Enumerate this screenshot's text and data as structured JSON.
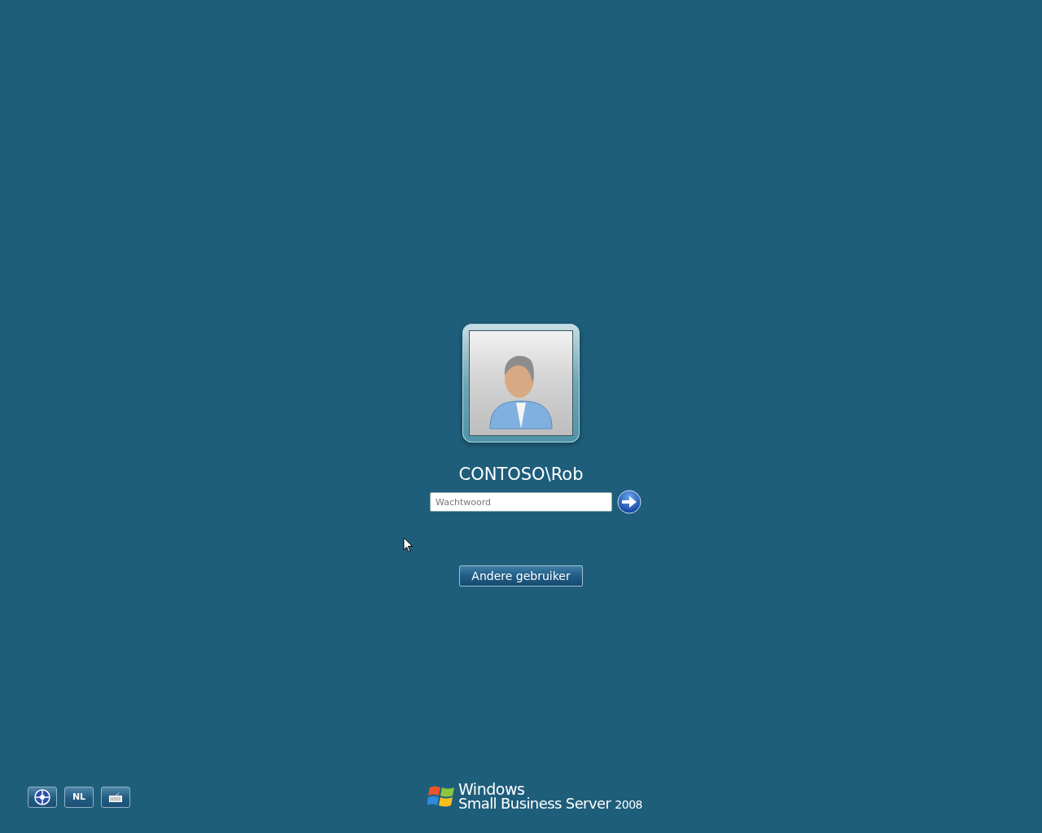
{
  "user": {
    "name": "CONTOSO\\Rob"
  },
  "password": {
    "placeholder": "Wachtwoord"
  },
  "switch_user_button": "Andere gebruiker",
  "bottom_buttons": [
    {
      "kind": "ease"
    },
    {
      "kind": "language",
      "label": "NL"
    },
    {
      "kind": "keyboard"
    }
  ],
  "brand": {
    "name": "Windows",
    "product": "Small Business Server",
    "version": "2008"
  }
}
